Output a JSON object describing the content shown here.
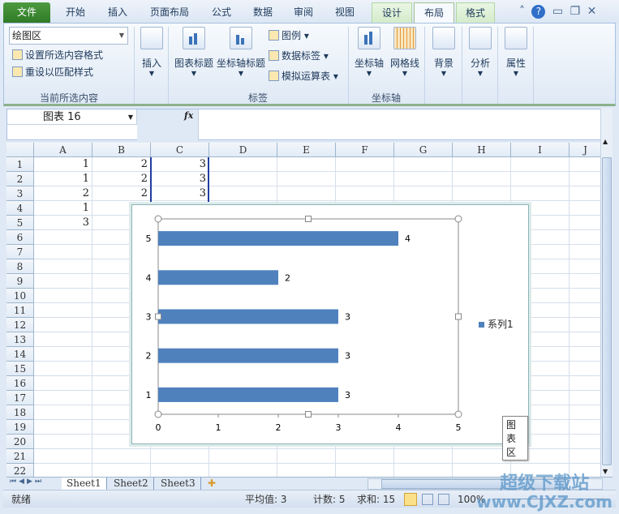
{
  "tabs": [
    "文件",
    "开始",
    "插入",
    "页面布局",
    "公式",
    "数据",
    "审阅",
    "视图",
    "设计",
    "布局",
    "格式"
  ],
  "active_tab": "布局",
  "window_icons": [
    "minimize-ribbon-icon",
    "help-icon",
    "minimize-icon",
    "restore-icon",
    "close-icon"
  ],
  "ribbon": {
    "selection_dropdown": "绘图区",
    "format_selection": "设置所选内容格式",
    "reset_style": "重设以匹配样式",
    "group_current": "当前所选内容",
    "insert": "插入",
    "chart_title": "图表标题",
    "axis_titles": "坐标轴标题",
    "legend": "图例",
    "data_labels": "数据标签",
    "data_table": "模拟运算表",
    "group_labels": "标签",
    "axes": "坐标轴",
    "gridlines": "网格线",
    "group_axes": "坐标轴",
    "background": "背景",
    "analysis": "分析",
    "properties": "属性"
  },
  "formula_bar": {
    "name_box": "图表 16",
    "fx": "fx",
    "value": ""
  },
  "columns": [
    "A",
    "B",
    "C",
    "D",
    "E",
    "F",
    "G",
    "H",
    "I",
    "J"
  ],
  "rows": [
    "1",
    "2",
    "3",
    "4",
    "5",
    "6",
    "7",
    "8",
    "9",
    "10",
    "11",
    "12",
    "13",
    "14",
    "15",
    "16",
    "17",
    "18",
    "19",
    "20",
    "21",
    "22"
  ],
  "cells": [
    {
      "row": 1,
      "col": "A",
      "v": "1"
    },
    {
      "row": 1,
      "col": "B",
      "v": "2"
    },
    {
      "row": 1,
      "col": "C",
      "v": "3"
    },
    {
      "row": 2,
      "col": "A",
      "v": "1"
    },
    {
      "row": 2,
      "col": "B",
      "v": "2"
    },
    {
      "row": 2,
      "col": "C",
      "v": "3"
    },
    {
      "row": 3,
      "col": "A",
      "v": "2"
    },
    {
      "row": 3,
      "col": "B",
      "v": "2"
    },
    {
      "row": 3,
      "col": "C",
      "v": "3"
    },
    {
      "row": 4,
      "col": "A",
      "v": "1"
    },
    {
      "row": 5,
      "col": "A",
      "v": "3"
    }
  ],
  "sheets": [
    "Sheet1",
    "Sheet2",
    "Sheet3"
  ],
  "active_sheet": "Sheet1",
  "status": {
    "ready": "就绪",
    "average": "平均值: 3",
    "count": "计数: 5",
    "sum": "求和: 15",
    "zoom": "100%"
  },
  "watermark": {
    "line1": "超级下载站",
    "line2": "www.CJXZ.com"
  },
  "chart_tooltip": "图表区",
  "chart_data": {
    "type": "bar",
    "orientation": "horizontal",
    "categories": [
      "1",
      "2",
      "3",
      "4",
      "5"
    ],
    "series": [
      {
        "name": "系列1",
        "values": [
          3,
          3,
          3,
          2,
          4
        ],
        "color": "#4f81bd"
      }
    ],
    "data_labels": true,
    "xlim": [
      0,
      5
    ],
    "xticks": [
      "0",
      "1",
      "2",
      "3",
      "4",
      "5"
    ],
    "legend": "right",
    "grid": false
  }
}
